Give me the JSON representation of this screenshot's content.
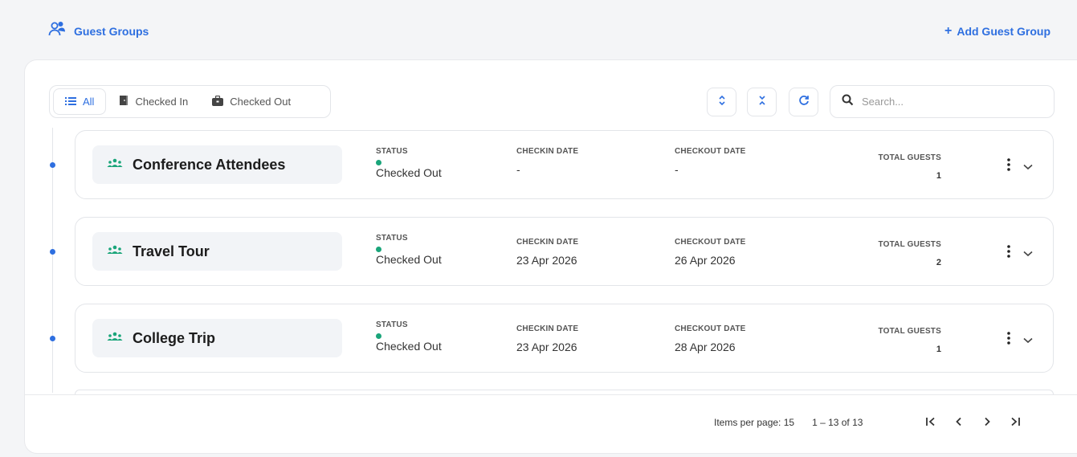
{
  "header": {
    "title": "Guest Groups",
    "add_label": "Add Guest Group",
    "add_icon": "+"
  },
  "filters": {
    "tabs": [
      {
        "label": "All",
        "icon": "list-icon",
        "active": true
      },
      {
        "label": "Checked In",
        "icon": "door-icon",
        "active": false
      },
      {
        "label": "Checked Out",
        "icon": "suitcase-icon",
        "active": false
      }
    ]
  },
  "toolbar": {
    "search_placeholder": "Search...",
    "search_value": ""
  },
  "colors": {
    "accent": "#2e6fe0",
    "status_green": "#1aa57a"
  },
  "columns": {
    "status": "STATUS",
    "checkin": "CHECKIN DATE",
    "checkout": "CHECKOUT DATE",
    "total": "TOTAL GUESTS"
  },
  "groups": [
    {
      "name": "Conference Attendees",
      "status": "Checked Out",
      "checkin": "-",
      "checkout": "-",
      "total": "1"
    },
    {
      "name": "Travel Tour",
      "status": "Checked Out",
      "checkin": "23 Apr 2026",
      "checkout": "26 Apr 2026",
      "total": "2"
    },
    {
      "name": "College Trip",
      "status": "Checked Out",
      "checkin": "23 Apr 2026",
      "checkout": "28 Apr 2026",
      "total": "1"
    }
  ],
  "pagination": {
    "items_per_page_label": "Items per page: 15",
    "range": "1 – 13 of 13"
  }
}
